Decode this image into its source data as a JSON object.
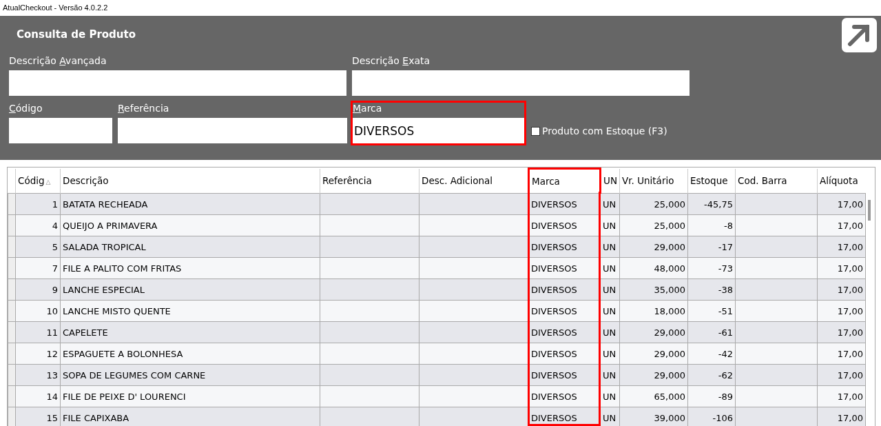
{
  "window": {
    "title": "AtualCheckout - Versão 4.0.2.2"
  },
  "panel": {
    "title": "Consulta de Produto",
    "fields": [
      {
        "label": {
          "before": "Descrição ",
          "key": "A",
          "after": "vançada"
        },
        "highlighted": false
      },
      {
        "label": {
          "before": "Descrição ",
          "key": "E",
          "after": "xata"
        },
        "highlighted": false
      },
      {
        "label": {
          "key": "C",
          "after": "ódigo"
        },
        "highlighted": false
      },
      {
        "label": {
          "key": "R",
          "after": "eferência"
        },
        "highlighted": false
      },
      {
        "label": {
          "key": "M",
          "after": "arca"
        },
        "value": "DIVERSOS",
        "highlighted": true
      }
    ],
    "stock_filter": {
      "label": "Produto com Estoque (F3)",
      "checked": false
    }
  },
  "table": {
    "columns": [
      {
        "label": "Códig",
        "kind": "number",
        "sort_icon": "△",
        "highlighted": false
      },
      {
        "label": "Descrição",
        "kind": "text",
        "highlighted": false
      },
      {
        "label": "Referência",
        "kind": "text",
        "highlighted": false
      },
      {
        "label": "Desc. Adicional",
        "kind": "text",
        "highlighted": false
      },
      {
        "label": "Marca",
        "kind": "text",
        "highlighted": true
      },
      {
        "label": "UN",
        "kind": "text",
        "highlighted": false
      },
      {
        "label": "Vr. Unitário",
        "kind": "number",
        "highlighted": false
      },
      {
        "label": "Estoque",
        "kind": "number",
        "highlighted": false
      },
      {
        "label": "Cod. Barra",
        "kind": "text",
        "highlighted": false
      },
      {
        "label": "Alíquota",
        "kind": "number",
        "highlighted": false
      }
    ],
    "rows": [
      [
        "1",
        "BATATA RECHEADA",
        "",
        "",
        "DIVERSOS",
        "UN",
        "25,000",
        "-45,75",
        "",
        "17,00"
      ],
      [
        "4",
        "QUEIJO A PRIMAVERA",
        "",
        "",
        "DIVERSOS",
        "UN",
        "25,000",
        "-8",
        "",
        "17,00"
      ],
      [
        "5",
        "SALADA TROPICAL",
        "",
        "",
        "DIVERSOS",
        "UN",
        "29,000",
        "-17",
        "",
        "17,00"
      ],
      [
        "7",
        "FILE A PALITO COM FRITAS",
        "",
        "",
        "DIVERSOS",
        "UN",
        "48,000",
        "-73",
        "",
        "17,00"
      ],
      [
        "9",
        "LANCHE ESPECIAL",
        "",
        "",
        "DIVERSOS",
        "UN",
        "35,000",
        "-38",
        "",
        "17,00"
      ],
      [
        "10",
        "LANCHE MISTO QUENTE",
        "",
        "",
        "DIVERSOS",
        "UN",
        "18,000",
        "-51",
        "",
        "17,00"
      ],
      [
        "11",
        "CAPELETE",
        "",
        "",
        "DIVERSOS",
        "UN",
        "29,000",
        "-61",
        "",
        "17,00"
      ],
      [
        "12",
        "ESPAGUETE  A BOLONHESA",
        "",
        "",
        "DIVERSOS",
        "UN",
        "29,000",
        "-42",
        "",
        "17,00"
      ],
      [
        "13",
        "SOPA DE LEGUMES COM CARNE",
        "",
        "",
        "DIVERSOS",
        "UN",
        "29,000",
        "-62",
        "",
        "17,00"
      ],
      [
        "14",
        "FILE DE PEIXE D' LOURENCI",
        "",
        "",
        "DIVERSOS",
        "UN",
        "65,000",
        "-89",
        "",
        "17,00"
      ],
      [
        "15",
        "FILE CAPIXABA",
        "",
        "",
        "DIVERSOS",
        "UN",
        "39,000",
        "-106",
        "",
        "17,00"
      ]
    ]
  }
}
